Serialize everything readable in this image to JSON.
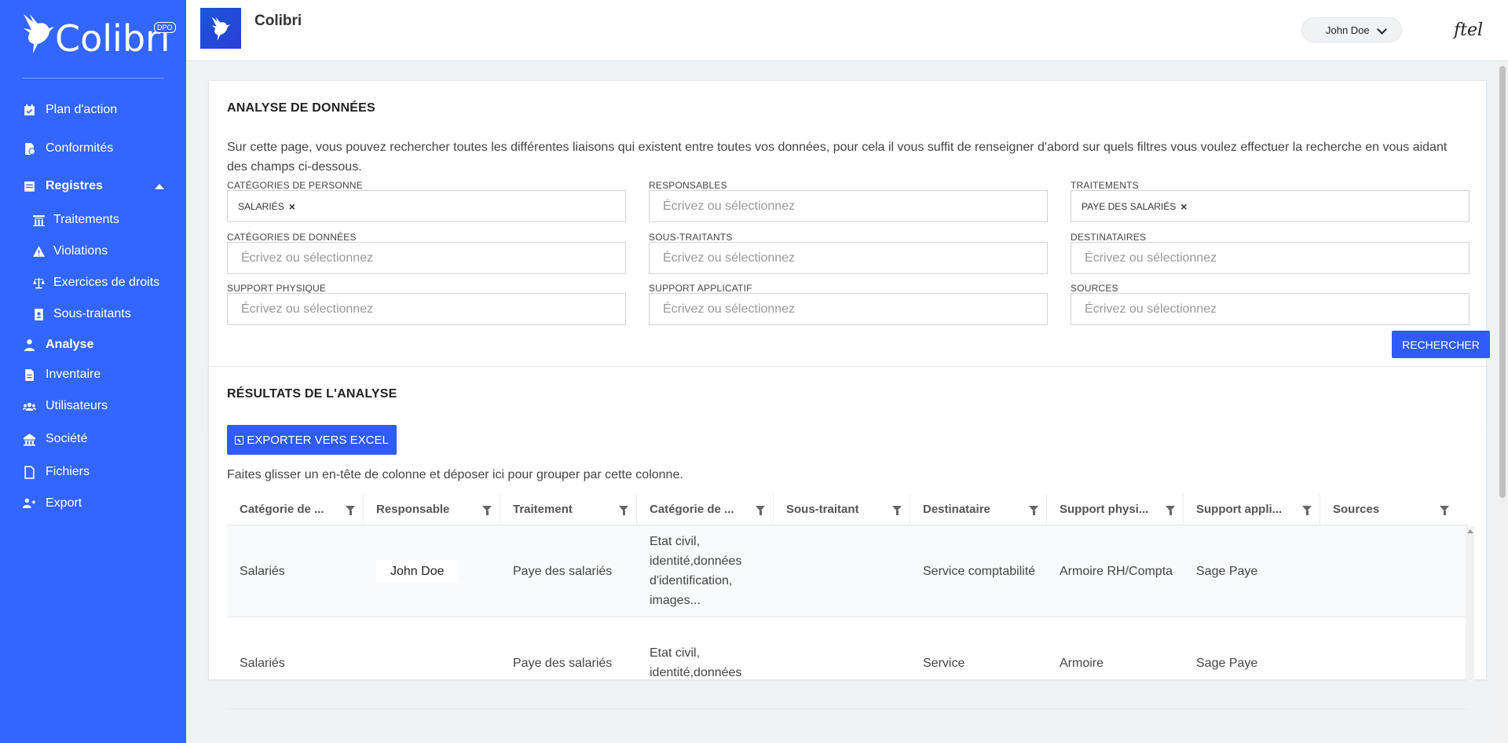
{
  "sidebar": {
    "brand": "Colibri",
    "badge": "DPO",
    "items": [
      {
        "label": "Plan d'action"
      },
      {
        "label": "Conformités"
      },
      {
        "label": "Registres"
      },
      {
        "label": "Traitements"
      },
      {
        "label": "Violations"
      },
      {
        "label": "Exercices de droits"
      },
      {
        "label": "Sous-traitants"
      },
      {
        "label": "Analyse"
      },
      {
        "label": "Inventaire"
      },
      {
        "label": "Utilisateurs"
      },
      {
        "label": "Société"
      },
      {
        "label": "Fichiers"
      },
      {
        "label": "Export"
      }
    ],
    "accent": "#3366ff"
  },
  "header": {
    "title": "Colibri",
    "user": "John Doe",
    "brand": "ftel"
  },
  "analysis": {
    "title": "ANALYSE DE DONNÉES",
    "description": "Sur cette page, vous pouvez rechercher toutes les différentes liaisons qui existent entre toutes vos données, pour cela il vous suffit de renseigner d'abord sur quels filtres vous voulez effectuer la recherche en vous aidant des champs ci-dessous.",
    "placeholder": "Écrivez ou sélectionnez",
    "filters": [
      {
        "label": "CATÉGORIES DE PERSONNE",
        "tag": "SALARIÉS"
      },
      {
        "label": "RESPONSABLES"
      },
      {
        "label": "TRAITEMENTS",
        "tag": "PAYE DES SALARIÉS"
      },
      {
        "label": "CATÉGORIES DE DONNÉES"
      },
      {
        "label": "SOUS-TRAITANTS"
      },
      {
        "label": "DESTINATAIRES"
      },
      {
        "label": "SUPPORT PHYSIQUE"
      },
      {
        "label": "SUPPORT APPLICATIF"
      },
      {
        "label": "SOURCES"
      }
    ],
    "search_label": "RECHERCHER"
  },
  "results": {
    "title": "RÉSULTATS DE L'ANALYSE",
    "export_label": "EXPORTER VERS EXCEL",
    "group_hint": "Faites glisser un en-tête de colonne et déposer ici pour grouper par cette colonne.",
    "columns": [
      "Catégorie de ...",
      "Responsable",
      "Traitement",
      "Catégorie de ...",
      "Sous-traitant",
      "Destinataire",
      "Support physi...",
      "Support appli...",
      "Sources"
    ],
    "rows": [
      [
        "Salariés",
        "John Doe",
        "Paye des salariés",
        "Etat civil, identité,données d'identification, images...",
        "",
        "Service comptabilité",
        "Armoire RH/Compta",
        "Sage Paye",
        ""
      ],
      [
        "Salariés",
        "",
        "Paye des salariés",
        "Etat civil, identité,données",
        "",
        "Service",
        "Armoire",
        "Sage Paye",
        ""
      ]
    ]
  }
}
